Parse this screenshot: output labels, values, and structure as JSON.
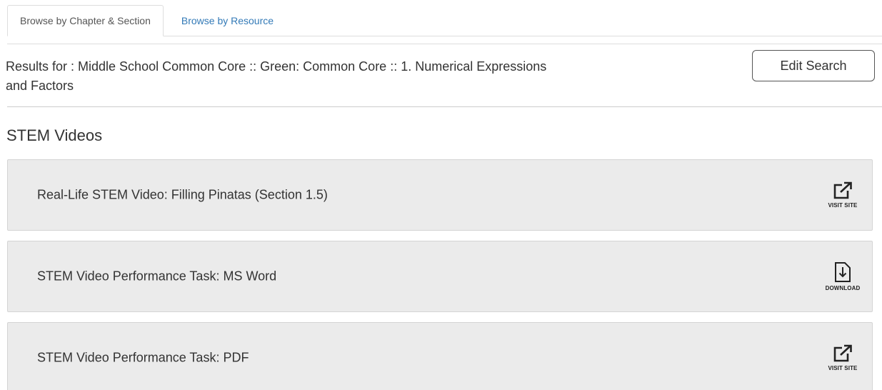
{
  "tabs": [
    {
      "label": "Browse by Chapter & Section",
      "active": true
    },
    {
      "label": "Browse by Resource",
      "active": false
    }
  ],
  "results": {
    "text": "Results for : Middle School Common Core :: Green: Common Core :: 1. Numerical Expressions and Factors",
    "edit_label": "Edit Search"
  },
  "section": {
    "title": "STEM Videos"
  },
  "resources": [
    {
      "title": "Real-Life STEM Video: Filling Pinatas (Section 1.5)",
      "action": "VISIT SITE",
      "icon": "external-link-icon"
    },
    {
      "title": "STEM Video Performance Task: MS Word",
      "action": "DOWNLOAD",
      "icon": "download-icon"
    },
    {
      "title": "STEM Video Performance Task: PDF",
      "action": "VISIT SITE",
      "icon": "external-link-icon"
    }
  ],
  "colors": {
    "link": "#337ab7",
    "row_bg": "#ebebeb",
    "text": "#333333"
  }
}
